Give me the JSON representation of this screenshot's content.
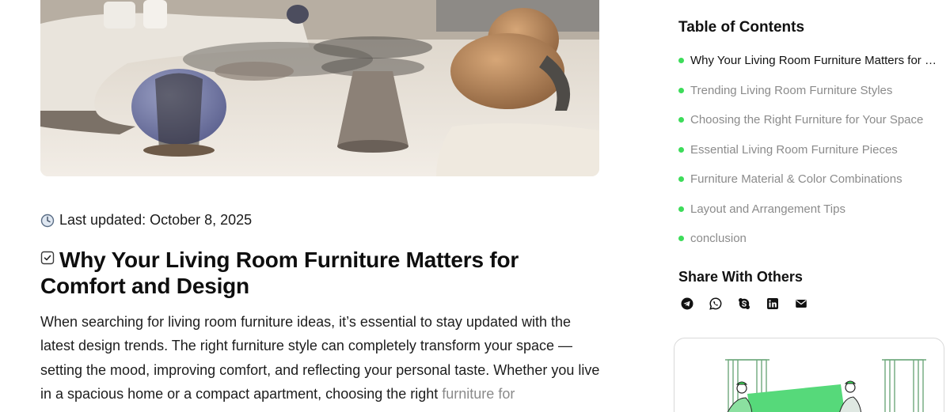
{
  "hero": {
    "image_subject": "living room furniture photo"
  },
  "article": {
    "updated_icon": "clock-icon",
    "updated_text": "Last updated: October 8, 2025",
    "heading_icon": "checkbox-icon",
    "heading": "Why Your Living Room Furniture Matters for Comfort and Design",
    "paragraph_text": "When searching for living room furniture ideas, it’s essential to stay updated with the latest design trends. The right furniture style can completely transform your space — setting the mood, improving comfort, and reflecting your personal taste. Whether you live in a spacious home or a compact apartment, choosing the right ",
    "paragraph_link": "furniture for"
  },
  "sidebar": {
    "toc_title": "Table of Contents",
    "toc_items": [
      {
        "label": "Why Your Living Room Furniture Matters for Comfort and Design",
        "active": true
      },
      {
        "label": "Trending Living Room Furniture Styles",
        "active": false
      },
      {
        "label": "Choosing the Right Furniture for Your Space",
        "active": false
      },
      {
        "label": "Essential Living Room Furniture Pieces",
        "active": false
      },
      {
        "label": "Furniture Material & Color Combinations",
        "active": false
      },
      {
        "label": "Layout and Arrangement Tips",
        "active": false
      },
      {
        "label": "conclusion",
        "active": false
      }
    ],
    "toc_dot_color": "#3ddc5a",
    "share_title": "Share With Others",
    "share_icons": [
      "telegram-icon",
      "whatsapp-icon",
      "skype-icon",
      "linkedin-icon",
      "email-icon"
    ],
    "promo_accent": "#3ddc5a"
  }
}
